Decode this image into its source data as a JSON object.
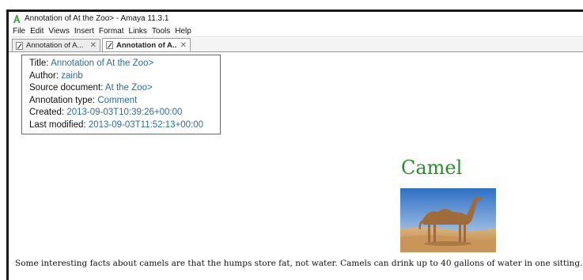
{
  "window": {
    "title": "Annotation of At the Zoo> - Amaya 11.3.1",
    "icon": "amaya-app-icon"
  },
  "menubar": {
    "items": [
      "File",
      "Edit",
      "Views",
      "Insert",
      "Format",
      "Links",
      "Tools",
      "Help"
    ]
  },
  "tabs": [
    {
      "label": "Annotation of A...",
      "icon": "document-pen-icon",
      "active": false
    },
    {
      "label": "Annotation of A...",
      "icon": "document-pen-icon",
      "active": true
    }
  ],
  "annotation": {
    "title_label": "Title:",
    "title_value": "Annotation of At the Zoo>",
    "author_label": "Author:",
    "author_value": "zainb",
    "source_label": "Source document:",
    "source_value": "At the Zoo>",
    "type_label": "Annotation type:",
    "type_value": "Comment",
    "created_label": "Created:",
    "created_value": "2013-09-03T10:39:26+00:00",
    "modified_label": "Last modified:",
    "modified_value": "2013-09-03T11:52:13+00:00"
  },
  "document": {
    "heading": "Camel",
    "image": "camel-photo",
    "paragraph": "Some interesting facts about camels are that the humps store fat, not water. Camels can drink up to 40 gallons of water in one sitting."
  },
  "colors": {
    "heading": "#2e8b2e",
    "link_value": "#2b6ca3"
  }
}
